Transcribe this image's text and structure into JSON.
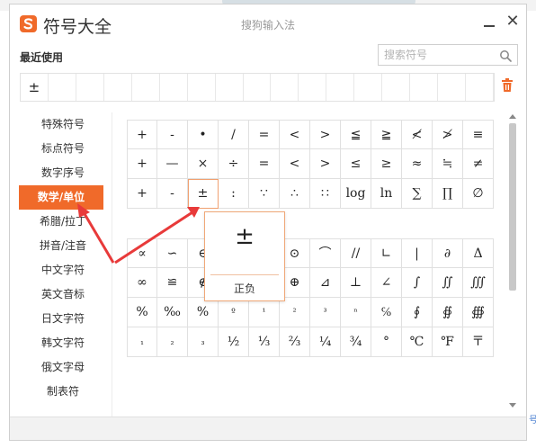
{
  "window": {
    "app_title": "符号大全",
    "subtitle": "搜狗输入法",
    "close_label": "✕"
  },
  "recent": {
    "title": "最近使用",
    "items": [
      "±",
      "",
      "",
      "",
      "",
      "",
      "",
      "",
      "",
      "",
      "",
      "",
      "",
      "",
      "",
      "",
      ""
    ]
  },
  "search": {
    "placeholder": "搜索符号"
  },
  "sidebar": {
    "items": [
      "特殊符号",
      "标点符号",
      "数字序号",
      "数学/单位",
      "希腊/拉丁",
      "拼音/注音",
      "中文字符",
      "英文音标",
      "日文字符",
      "韩文字符",
      "俄文字母",
      "制表符"
    ],
    "active_index": 3
  },
  "grid": {
    "rows_top": [
      [
        "+",
        "-",
        "•",
        "/",
        "=",
        "<",
        ">",
        "≦",
        "≧",
        "≮",
        "≯",
        "≡"
      ],
      [
        "+",
        "—",
        "×",
        "÷",
        "=",
        "<",
        ">",
        "≤",
        "≥",
        "≈",
        "≒",
        "≠"
      ],
      [
        "+",
        "-",
        "±",
        ":",
        "∵",
        "∴",
        "∷",
        "log",
        "ln",
        "∑",
        "∏",
        "∅"
      ]
    ],
    "rows_bottom": [
      [
        "∝",
        "∽",
        "∈",
        "",
        "",
        "⊙",
        "⌒",
        "//",
        "∟",
        "|",
        "∂",
        "Δ"
      ],
      [
        "∞",
        "≌",
        "∉",
        "",
        "",
        "⊕",
        "⊿",
        "⊥",
        "∠",
        "∫",
        "∬",
        "∭"
      ],
      [
        "%",
        "‰",
        "%",
        "º",
        "¹",
        "²",
        "³",
        "ⁿ",
        "℅",
        "∮",
        "∯",
        "∰"
      ],
      [
        "₁",
        "₂",
        "₃",
        "½",
        "⅓",
        "⅔",
        "¼",
        "¾",
        "°",
        "℃",
        "℉",
        "〒"
      ]
    ]
  },
  "tooltip": {
    "symbol": "±",
    "name": "正负"
  },
  "edge_fragment": "号",
  "colors": {
    "accent": "#f06a2a",
    "arrow": "#e83a3a"
  }
}
